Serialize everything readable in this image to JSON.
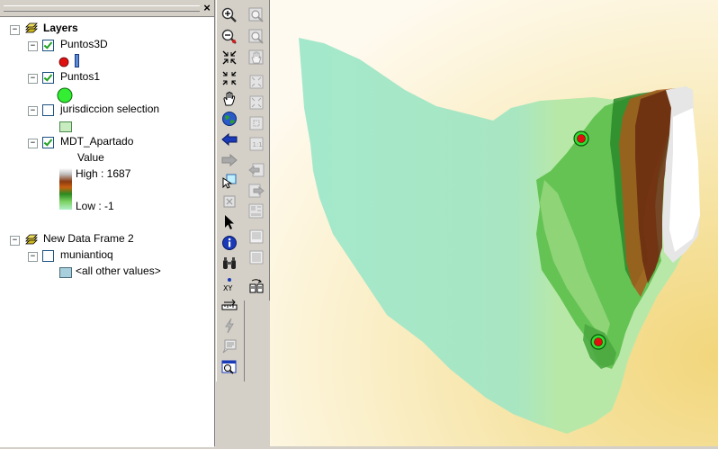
{
  "toc": {
    "close_glyph": "×",
    "frames": [
      {
        "name": "Layers",
        "layers": [
          {
            "name": "Puntos3D",
            "checked": true
          },
          {
            "name": "Puntos1",
            "checked": true
          },
          {
            "name": "jurisdiccion selection",
            "checked": false
          },
          {
            "name": "MDT_Apartado",
            "checked": true,
            "legend_title": "Value",
            "high_label": "High : 1687",
            "low_label": "Low : -1"
          }
        ]
      },
      {
        "name": "New Data Frame 2",
        "layers": [
          {
            "name": "muniantioq",
            "checked": false,
            "legend_item": "<all other values>"
          }
        ]
      }
    ]
  },
  "toolbar1": {
    "tools": [
      "zoom-in-icon",
      "zoom-out-icon",
      "fixed-zoom-in-icon",
      "fixed-zoom-out-icon",
      "pan-icon",
      "full-extent-icon",
      "back-extent-icon",
      "forward-extent-icon",
      "select-features-icon",
      "clear-selection-icon",
      "select-elements-icon",
      "identify-icon",
      "find-icon",
      "go-to-xy-icon",
      "measure-icon",
      "hyperlink-icon",
      "html-popup-icon",
      "time-slider-icon"
    ]
  },
  "toolbar2": {
    "tools": [
      "zoom-in-layout-icon",
      "zoom-out-layout-icon",
      "pan-layout-icon",
      "zoom-whole-page-icon",
      "zoom-100-icon",
      "fixed-zoom-in-layout-icon",
      "fixed-zoom-out-layout-icon",
      "go-back-extent-icon",
      "go-forward-extent-icon",
      "zoom-control-icon",
      "toggle-draft-icon",
      "focus-data-frame-icon",
      "change-layout-icon",
      "data-driven-pages-icon"
    ]
  },
  "colors": {
    "point_fill": "#e01010",
    "point_ring": "#22cc22",
    "puntos1_fill": "#33ee33",
    "jurisdiccion_fill": "#c8ecc0",
    "muniantioq_fill": "#a8d0dc",
    "dem_low": "#9de8c8",
    "dem_high": "#ffffff"
  }
}
